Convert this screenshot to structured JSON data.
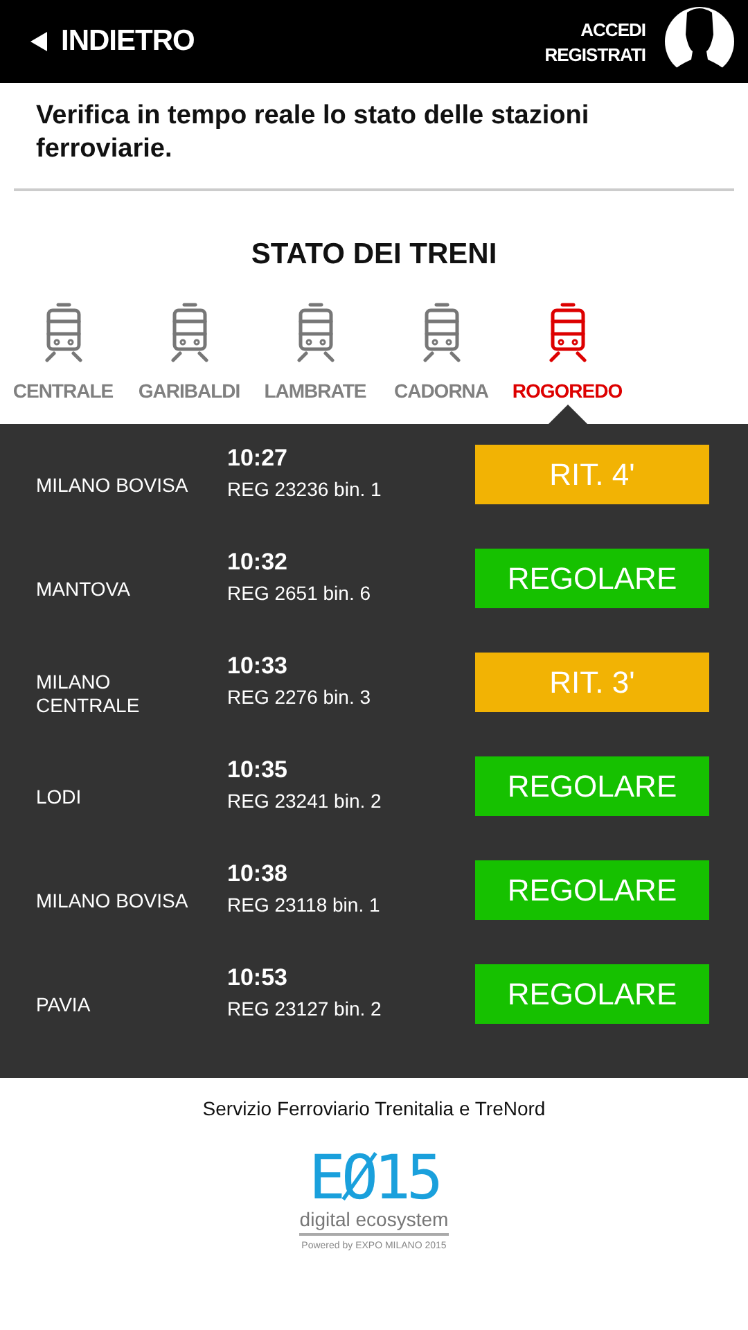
{
  "header": {
    "back": "INDIETRO",
    "login": "ACCEDI",
    "register": "REGISTRATI"
  },
  "intro": "Verifica in tempo reale lo stato delle stazioni ferroviarie.",
  "section_title": "STATO DEI TRENI",
  "stations": [
    {
      "label": "CENTRALE",
      "selected": false
    },
    {
      "label": "GARIBALDI",
      "selected": false
    },
    {
      "label": "LAMBRATE",
      "selected": false
    },
    {
      "label": "CADORNA",
      "selected": false
    },
    {
      "label": "ROGOREDO",
      "selected": true
    }
  ],
  "trains": [
    {
      "destination": "MILANO BOVISA",
      "time": "10:27",
      "train": "REG 23236 bin. 1",
      "status": "RIT. 4'",
      "kind": "delay"
    },
    {
      "destination": "MANTOVA",
      "time": "10:32",
      "train": "REG 2651 bin. 6",
      "status": "REGOLARE",
      "kind": "regular"
    },
    {
      "destination": "MILANO CENTRALE",
      "time": "10:33",
      "train": "REG 2276 bin. 3",
      "status": "RIT. 3'",
      "kind": "delay"
    },
    {
      "destination": "LODI",
      "time": "10:35",
      "train": "REG 23241 bin. 2",
      "status": "REGOLARE",
      "kind": "regular"
    },
    {
      "destination": "MILANO BOVISA",
      "time": "10:38",
      "train": "REG 23118 bin. 1",
      "status": "REGOLARE",
      "kind": "regular"
    },
    {
      "destination": "PAVIA",
      "time": "10:53",
      "train": "REG 23127 bin. 2",
      "status": "REGOLARE",
      "kind": "regular"
    }
  ],
  "footer": {
    "credit": "Servizio Ferroviario Trenitalia e TreNord",
    "logo_mark": "EØ15",
    "logo_tagline": "digital ecosystem",
    "logo_powered": "Powered by EXPO MILANO 2015"
  }
}
